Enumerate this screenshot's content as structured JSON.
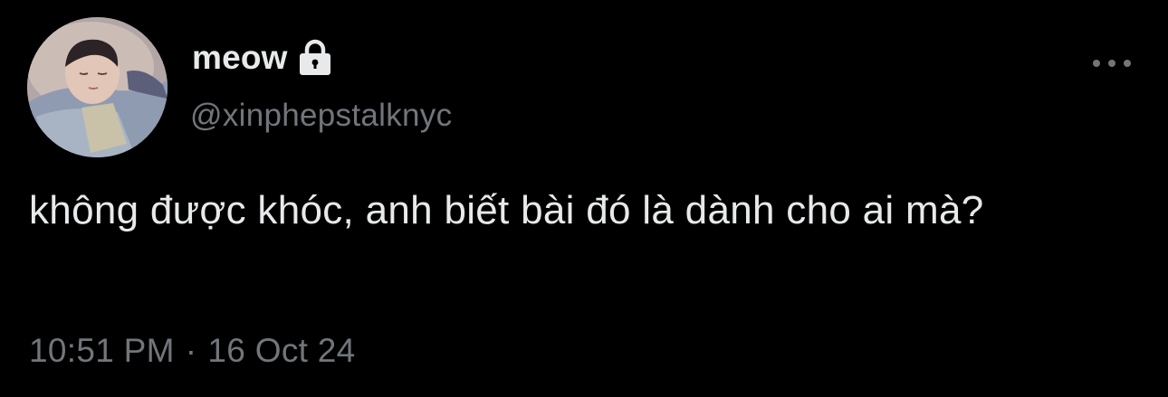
{
  "author": {
    "display_name": "meow",
    "handle": "@xinphepstalknyc",
    "protected": true,
    "avatar_icon": "avatar-photo-sleeping-child",
    "lock_icon": "lock-icon"
  },
  "tweet": {
    "text": "không được khóc, anh biết bài đó là dành cho ai mà?"
  },
  "meta": {
    "time": "10:51 PM",
    "separator": "·",
    "date": "16 Oct 24"
  },
  "colors": {
    "background": "#000000",
    "primary_text": "#e7e9ea",
    "secondary_text": "#71767b"
  }
}
